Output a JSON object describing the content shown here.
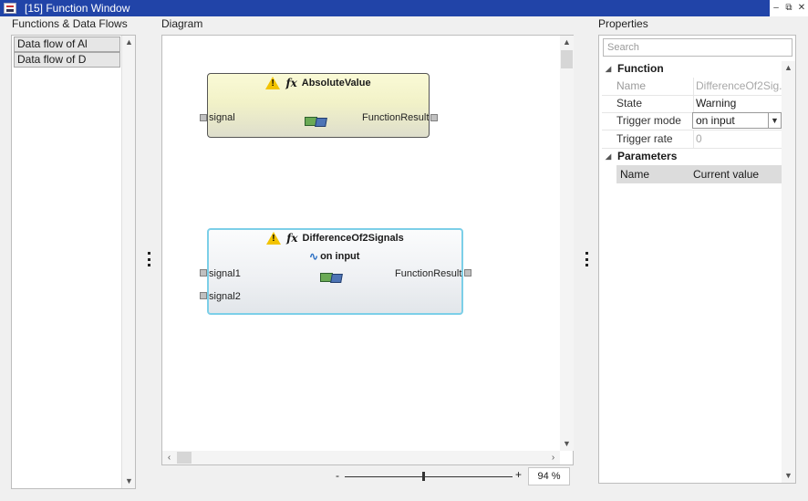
{
  "window": {
    "title": "[15] Function Window",
    "controls": [
      "–",
      "⧉",
      "✕"
    ]
  },
  "left_panel": {
    "header": "Functions & Data Flows",
    "items": [
      {
        "label": "Data flow of Al"
      },
      {
        "label": "Data flow of D"
      }
    ]
  },
  "diagram": {
    "header": "Diagram",
    "blocks": [
      {
        "name": "AbsoluteValue",
        "inputs": [
          "signal"
        ],
        "output": "FunctionResult"
      },
      {
        "name": "DifferenceOf2Signals",
        "trigger": "on input",
        "inputs": [
          "signal1",
          "signal2"
        ],
        "output": "FunctionResult"
      }
    ],
    "zoom": {
      "minus": "-",
      "plus": "+",
      "value": "94 %",
      "level": 0.47
    }
  },
  "properties": {
    "header": "Properties",
    "search_placeholder": "Search",
    "function_section": "Function",
    "rows": [
      {
        "key": "Name",
        "value": "DifferenceOf2Sig...",
        "disabled": true
      },
      {
        "key": "State",
        "value": "Warning",
        "disabled": false
      },
      {
        "key": "Trigger mode",
        "value": "on input",
        "disabled": false
      },
      {
        "key": "Trigger rate",
        "value": "0",
        "disabled": true
      }
    ],
    "parameters_section": "Parameters",
    "param_columns": [
      "Name",
      "Current value"
    ]
  },
  "colors": {
    "titlebar": "#2144a8",
    "selected_block_border": "#7ccfe8",
    "warning": "#f2c300"
  },
  "icons": [
    "app-icon",
    "warning-icon",
    "function-icon",
    "monitor-icon",
    "wave-icon",
    "chevron-down-icon",
    "splitter-grip-icon"
  ]
}
